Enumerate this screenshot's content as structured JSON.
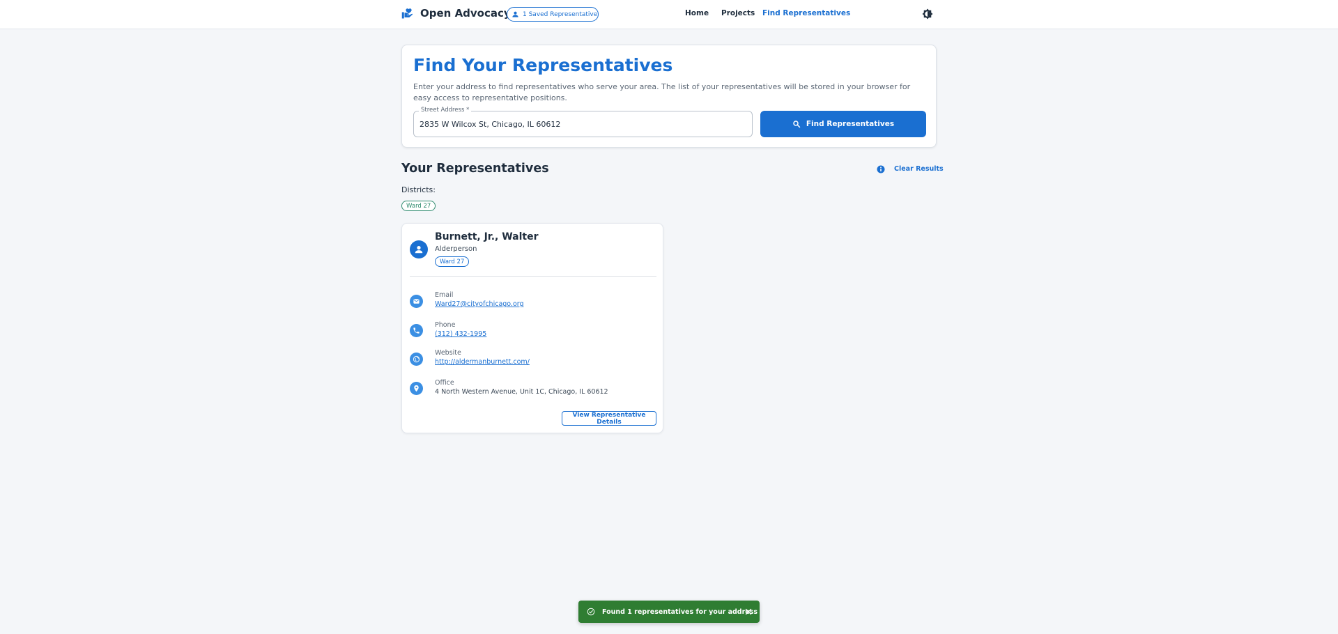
{
  "header": {
    "app_name": "Open Advocacy",
    "saved_pill": "1 Saved Representative",
    "nav": {
      "home": "Home",
      "projects": "Projects",
      "find": "Find Representatives"
    },
    "icons": {
      "brand": "hand-heart-icon",
      "theme": "theme-toggle-icon"
    }
  },
  "search": {
    "title": "Find Your Representatives",
    "description": "Enter your address to find representatives who serve your area. The list of your representatives will be stored in your browser for easy access to representative positions.",
    "address_label": "Street Address *",
    "address_value": "2835 W Wilcox St, Chicago, IL 60612",
    "button_label": "Find Representatives"
  },
  "results": {
    "title": "Your Representatives",
    "clear_label": "Clear Results",
    "districts_label": "Districts:",
    "districts": [
      "Ward 27"
    ]
  },
  "representative": {
    "name": "Burnett, Jr., Walter",
    "role": "Alderperson",
    "ward": "Ward 27",
    "email_label": "Email",
    "email": "Ward27@cityofchicago.org",
    "phone_label": "Phone",
    "phone": "(312) 432-1995",
    "website_label": "Website",
    "website": "http://aldermanburnett.com/",
    "office_label": "Office",
    "office": "4 North Western Avenue, Unit 1C, Chicago, IL 60612",
    "details_button": "View Representative Details"
  },
  "toast": {
    "message": "Found 1 representatives for your address"
  },
  "colors": {
    "primary": "#1a6fd1",
    "success": "#2f7d32",
    "district_chip": "#2e8b6e",
    "background": "#f4f6f9"
  }
}
